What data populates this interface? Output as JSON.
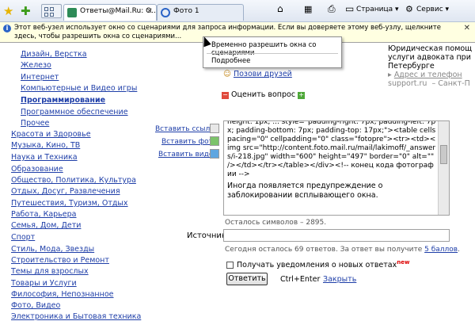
{
  "browser": {
    "tabs": [
      {
        "label": "Ответы@Mail.Ru: О...",
        "active": true
      },
      {
        "label": "Фото 1",
        "active": false
      }
    ],
    "commands": {
      "page": "Страница",
      "service": "Сервис"
    }
  },
  "infobar": {
    "text": "Этот веб-узел использует окно со сценариями для запроса информации. Если вы доверяете этому веб-узлу, щелкните здесь, чтобы разрешить окна со сценариями..."
  },
  "context_menu": {
    "items": [
      "Временно разрешить окна со сценариями",
      "Подробнее"
    ]
  },
  "categories": [
    {
      "label": "Дизайн, Верстка",
      "level": "sub"
    },
    {
      "label": "Железо",
      "level": "sub"
    },
    {
      "label": "Интернет",
      "level": "sub"
    },
    {
      "label": "Компьютерные и Видео игры",
      "level": "sub"
    },
    {
      "label": "Программирование",
      "level": "sub",
      "bold": true
    },
    {
      "label": "Программное обеспечение",
      "level": "sub"
    },
    {
      "label": "Прочее",
      "level": "sub"
    },
    {
      "label": "Красота и Здоровье",
      "level": "top"
    },
    {
      "label": "Музыка, Кино, ТВ",
      "level": "top"
    },
    {
      "label": "Наука и Техника",
      "level": "top"
    },
    {
      "label": "Образование",
      "level": "top"
    },
    {
      "label": "Общество, Политика, Культура",
      "level": "top"
    },
    {
      "label": "Отдых, Досуг, Развлечения",
      "level": "top"
    },
    {
      "label": "Путешествия, Туризм, Отдых",
      "level": "top"
    },
    {
      "label": "Работа, Карьера",
      "level": "top"
    },
    {
      "label": "Семья, Дом, Дети",
      "level": "top"
    },
    {
      "label": "Спорт",
      "level": "top"
    },
    {
      "label": "Стиль, Мода, Звезды",
      "level": "top"
    },
    {
      "label": "Строительство и Ремонт",
      "level": "top"
    },
    {
      "label": "Темы для взрослых",
      "level": "top"
    },
    {
      "label": "Товары и Услуги",
      "level": "top"
    },
    {
      "label": "Философия, Непознанное",
      "level": "top"
    },
    {
      "label": "Фото, Видео",
      "level": "top"
    },
    {
      "label": "Электроника и Бытовая техника",
      "level": "top"
    }
  ],
  "ad": {
    "line1": "Юридическая помощ",
    "line2": "услуги адвоката при",
    "line3": "Петербурге",
    "address_link": "Адрес и телефон",
    "source": "support.ru",
    "city": "Санкт-П"
  },
  "actions": {
    "invite_friends": "Позови друзей",
    "rate_question": "Оценить вопрос"
  },
  "editor_tools": {
    "insert_link": "Вставить ссылку",
    "insert_photo": "Вставить фото",
    "insert_video": "Вставить видео"
  },
  "editor": {
    "code": "height: 1px; ... style=\"padding-right: 7px; padding-left: 7px; padding-bottom: 7px; padding-top: 17px;\"><table cellspacing=\"0\" cellpadding=\"0\" class=\"fotopre\"><tr><td><img src=\"http://content.foto.mail.ru/mail/lakimoff/_answers/i-218.jpg\" width=\"600\" height=\"497\" border=\"0\" alt=\"\" /></td></tr></table></div><!-- конец кода фотографии -->",
    "note": "Иногда появляется предупреждение о заблокировании всплывающего окна."
  },
  "form": {
    "remaining_chars": "Осталось символов – 2895.",
    "source_label": "Источник:",
    "source_value": "",
    "quota_text": "Сегодня осталось 69 ответов. За ответ вы получите",
    "quota_link": "5 баллов",
    "notify_label": "Получать уведомления о новых ответах",
    "notify_badge": "new",
    "submit": "Ответить",
    "shortcut": "Ctrl+Enter",
    "close": "Закрыть"
  }
}
